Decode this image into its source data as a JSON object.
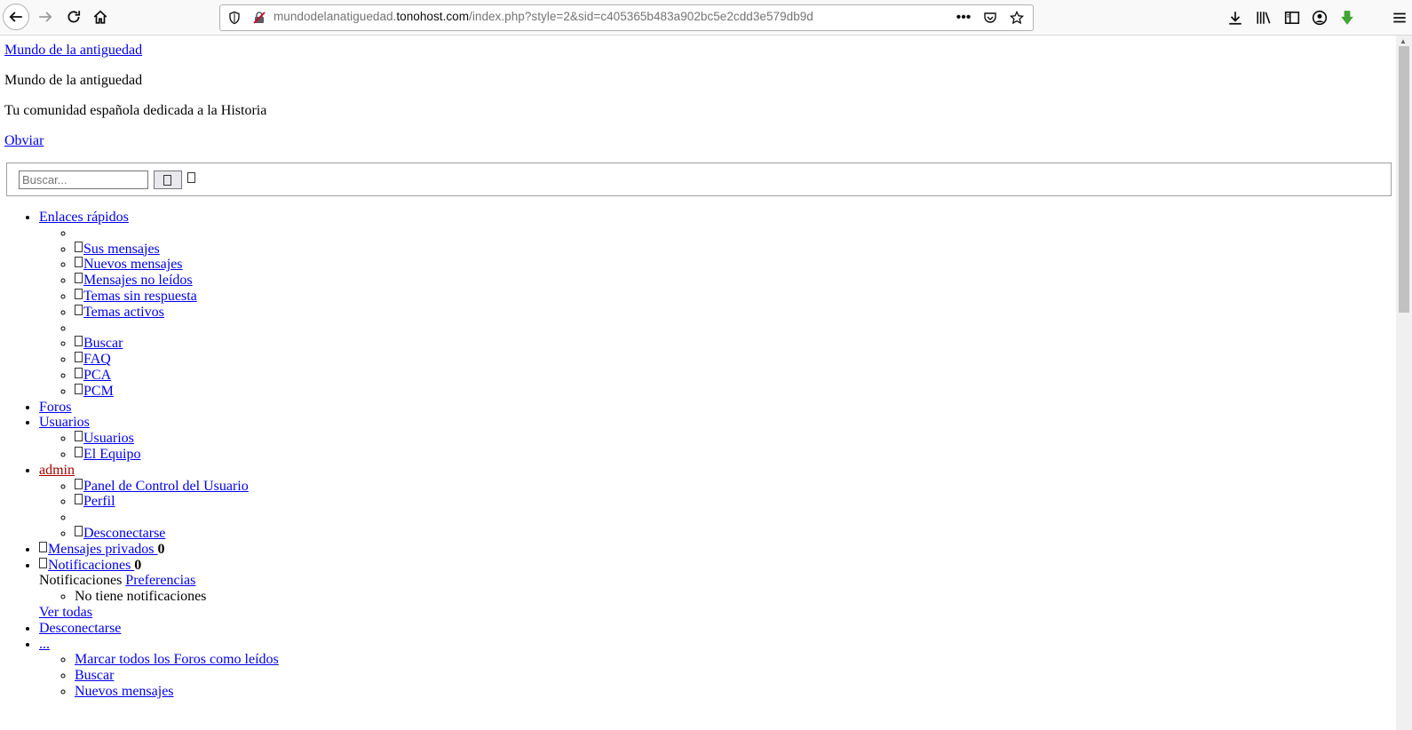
{
  "browser": {
    "url_prefix": "mundodelanatiguedad.",
    "url_domain": "tonohost.com",
    "url_path": "/index.php?style=2&sid=c405365b483a902bc5e2cdd3e579db9d",
    "icons": [
      "back-icon",
      "forward-icon",
      "reload-icon",
      "home-icon",
      "shield-icon",
      "insecure-lock-icon",
      "more-icon",
      "pocket-icon",
      "bookmark-star-icon",
      "download-icon",
      "library-icon",
      "sidebar-icon",
      "account-icon",
      "extension-icon",
      "menu-icon"
    ],
    "accent": "#0a84ff"
  },
  "header": {
    "site_link": "Mundo de la antiguedad",
    "site_title": "Mundo de la antiguedad",
    "tagline": "Tu comunidad española dedicada a la Historia",
    "skip_link": "Obviar"
  },
  "search": {
    "placeholder": "Buscar...",
    "button_glyph": "⍰",
    "advanced_glyph": "⍰"
  },
  "nav": {
    "quick_links": {
      "label": "Enlaces rápidos",
      "items": [
        "Sus mensajes",
        "Nuevos mensajes",
        "Mensajes no leídos",
        "Temas sin respuesta",
        "Temas activos"
      ],
      "items2": [
        "Buscar",
        "FAQ",
        "PCA",
        "PCM"
      ]
    },
    "forums": "Foros",
    "users": {
      "label": "Usuarios",
      "items": [
        "Usuarios",
        "El Equipo"
      ]
    },
    "account": {
      "label": "admin",
      "items": [
        "Panel de Control del Usuario",
        "Perfil"
      ],
      "logout": "Desconectarse"
    },
    "pm": {
      "label": "Mensajes privados ",
      "count": "0"
    },
    "notifications": {
      "label": "Notificaciones ",
      "count": "0",
      "header_text": "Notificaciones ",
      "prefs": "Preferencias",
      "empty": "No tiene notificaciones",
      "view_all": "Ver todas"
    },
    "logout": "Desconectarse",
    "more": {
      "label": "...",
      "items": [
        "Marcar todos los Foros como leídos",
        "Buscar",
        "Nuevos mensajes"
      ]
    }
  },
  "colors": {
    "link": "#0000ee",
    "admin": "#aa0000"
  }
}
